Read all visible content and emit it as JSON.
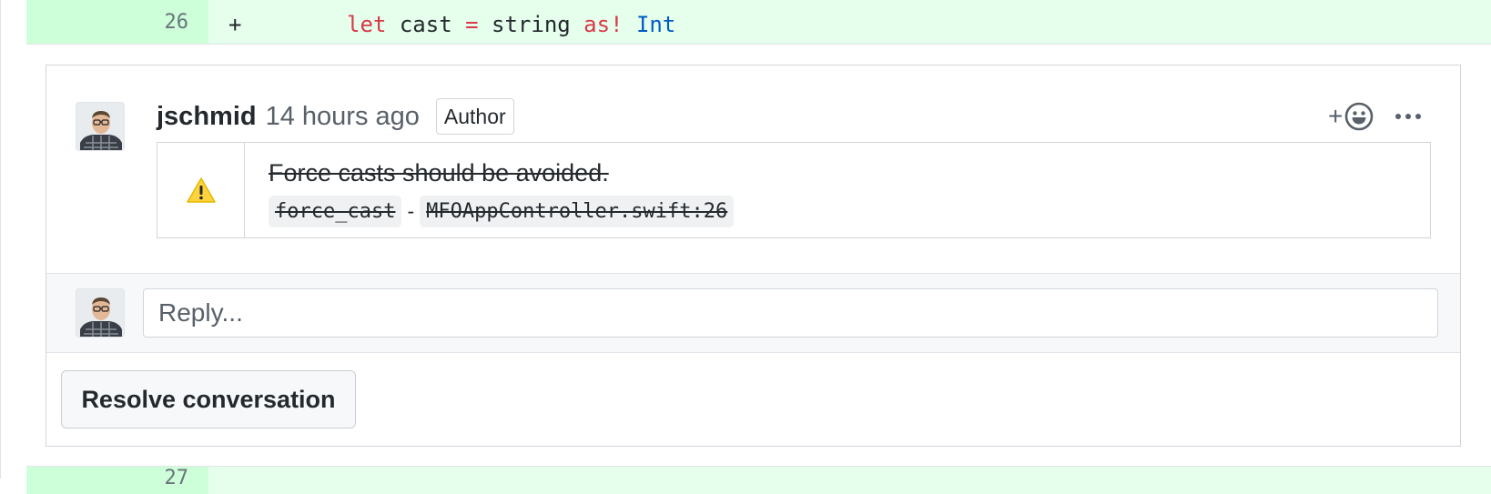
{
  "diff": {
    "top_line": {
      "number": "26",
      "marker": "+",
      "indent": "        ",
      "kw_let": "let",
      "var_name": "cast",
      "op_eq": "=",
      "value": "string",
      "kw_as": "as!",
      "type_name": "Int"
    },
    "bottom_line": {
      "number": "27"
    }
  },
  "comment": {
    "author": "jschmid",
    "timestamp": "14 hours ago",
    "badge": "Author",
    "reaction_plus": "+",
    "lint": {
      "message": "Force casts should be avoided.",
      "rule": "force_cast",
      "separator": "-",
      "location": "MFOAppController.swift:26"
    }
  },
  "reply": {
    "placeholder": "Reply..."
  },
  "actions": {
    "resolve_label": "Resolve conversation"
  },
  "icons": {
    "warning": "warning-icon",
    "emoji": "smiley-icon",
    "more": "kebab-horizontal-icon"
  },
  "colors": {
    "diff_added_bg": "#e6ffed",
    "diff_added_gutter": "#cdffd8",
    "keyword": "#d73a49",
    "type": "#005cc5",
    "warning": "#ffd33d"
  }
}
